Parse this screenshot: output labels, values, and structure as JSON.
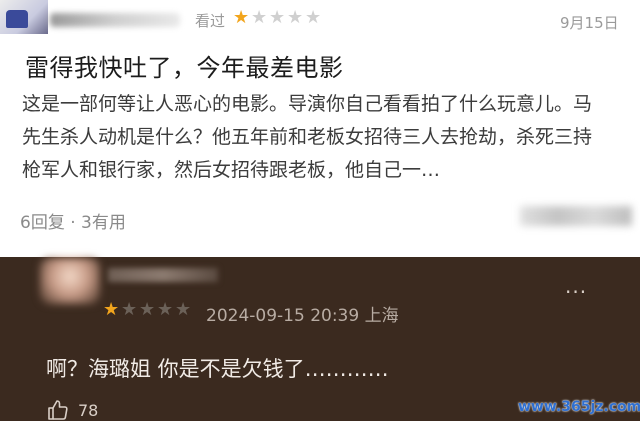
{
  "review": {
    "seen_label": "看过",
    "rating": {
      "filled": 1,
      "total": 5
    },
    "date": "9月15日",
    "title": "雷得我快吐了，今年最差电影",
    "body": "这是一部何等让人恶心的电影。导演你自己看看拍了什么玩意儿。马先生杀人动机是什么？他五年前和老板女招待三人去抢劫，杀死三持枪军人和银行家，然后女招待跟老板，他自己一…",
    "replies": "6回复",
    "separator": "·",
    "useful": "3有用"
  },
  "reply": {
    "rating": {
      "filled": 1,
      "total": 5
    },
    "timestamp": "2024-09-15 20:39 上海",
    "more_label": "···",
    "text": "啊？海璐姐 你是不是欠钱了…………",
    "likes": "78"
  },
  "watermark": "www.365jz.com",
  "colors": {
    "star_on": "#f2a51d",
    "dark_card_bg": "#3b2a1f",
    "watermark": "#2f6fd0"
  },
  "icons": {
    "star": "star-icon",
    "like": "thumbs-up-icon",
    "more": "more-dots-icon"
  }
}
